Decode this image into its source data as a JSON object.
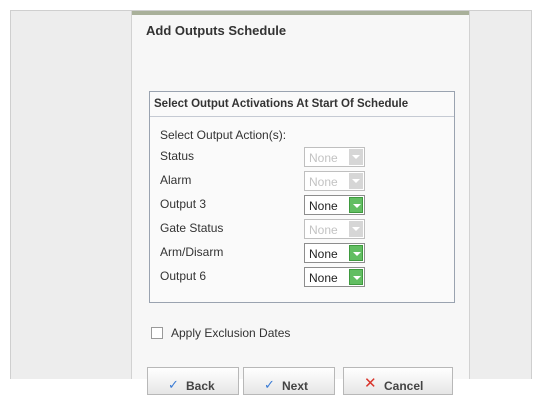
{
  "dialog": {
    "title": "Add Outputs Schedule"
  },
  "group": {
    "title": "Select Output Activations At Start Of Schedule",
    "sublabel": "Select Output Action(s):",
    "rows": [
      {
        "label": "Status",
        "value": "None",
        "enabled": false
      },
      {
        "label": "Alarm",
        "value": "None",
        "enabled": false
      },
      {
        "label": "Output 3",
        "value": "None",
        "enabled": true
      },
      {
        "label": "Gate Status",
        "value": "None",
        "enabled": false
      },
      {
        "label": "Arm/Disarm",
        "value": "None",
        "enabled": true
      },
      {
        "label": "Output 6",
        "value": "None",
        "enabled": true
      }
    ]
  },
  "exclusion": {
    "label": "Apply Exclusion Dates",
    "checked": false
  },
  "buttons": {
    "back": "Back",
    "next": "Next",
    "cancel": "Cancel"
  },
  "colors": {
    "enabled_arrow": "#62be62",
    "disabled_arrow": "#d6d6d6",
    "cancel_icon": "#d9342b"
  }
}
